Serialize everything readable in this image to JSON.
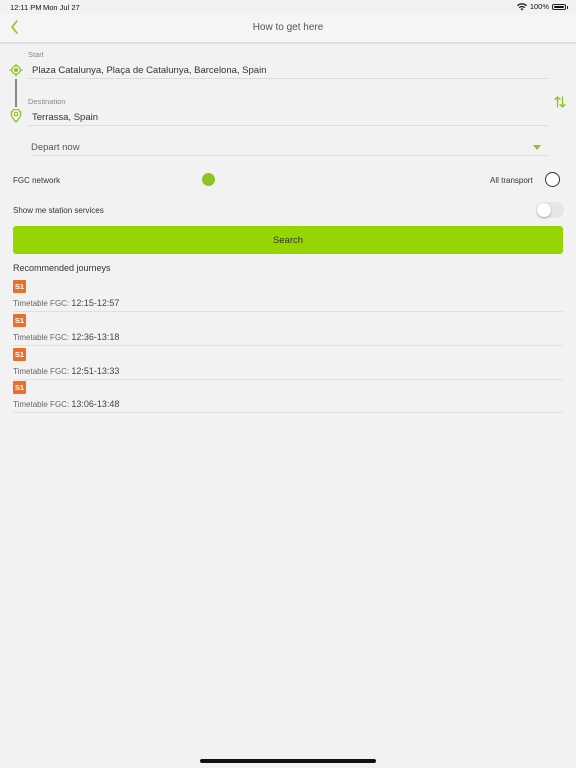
{
  "status_bar": {
    "time": "12:11 PM",
    "date": "Mon Jul 27",
    "battery": "100%"
  },
  "nav": {
    "title": "How to get here"
  },
  "start": {
    "label": "Start",
    "value": "Plaza Catalunya, Plaça de Catalunya, Barcelona, Spain"
  },
  "destination": {
    "label": "Destination",
    "value": "Terrassa, Spain"
  },
  "depart": {
    "value": "Depart now"
  },
  "network": {
    "fgc_label": "FGC network",
    "all_label": "All transport",
    "selected": "fgc"
  },
  "station_services": {
    "label": "Show me station services",
    "enabled": false
  },
  "search": {
    "label": "Search"
  },
  "journeys": {
    "title": "Recommended journeys",
    "items": [
      {
        "line": "S1",
        "prefix": "Timetable FGC: ",
        "time": "12:15-12:57"
      },
      {
        "line": "S1",
        "prefix": "Timetable FGC: ",
        "time": "12:36-13:18"
      },
      {
        "line": "S1",
        "prefix": "Timetable FGC: ",
        "time": "12:51-13:33"
      },
      {
        "line": "S1",
        "prefix": "Timetable FGC: ",
        "time": "13:06-13:48"
      }
    ]
  },
  "colors": {
    "accent": "#95d600",
    "icon_green": "#8fc31f",
    "line_badge": "#e8702a",
    "background": "#f2f2f2"
  },
  "icons": {
    "back": "chevron-left-icon",
    "start": "crosshair-location-icon",
    "destination": "map-pin-icon",
    "swap": "swap-vertical-icon",
    "wifi": "wifi-icon",
    "battery": "battery-icon"
  }
}
